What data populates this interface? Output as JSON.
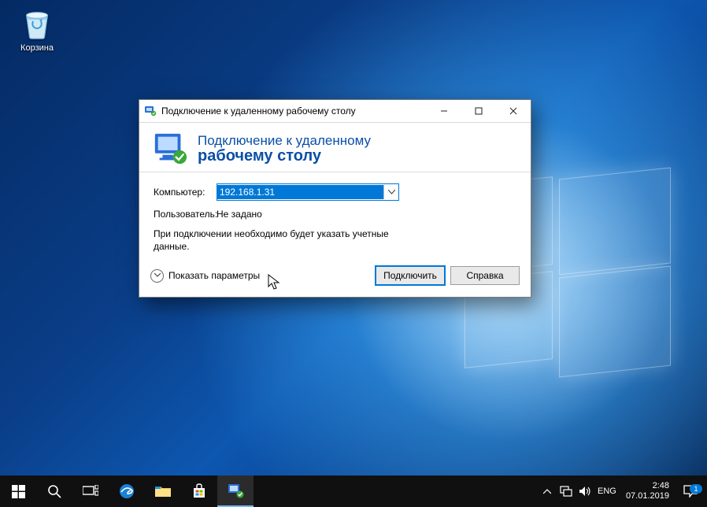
{
  "desktop": {
    "recycle_bin_label": "Корзина"
  },
  "window": {
    "title": "Подключение к удаленному рабочему столу",
    "banner_line1": "Подключение к удаленному",
    "banner_line2": "рабочему столу",
    "computer_label": "Компьютер:",
    "computer_value": "192.168.1.31",
    "user_label": "Пользователь:",
    "user_value": "Не задано",
    "credentials_note": "При подключении необходимо будет указать учетные данные.",
    "show_options": "Показать параметры",
    "connect_btn": "Подключить",
    "help_btn": "Справка"
  },
  "taskbar": {
    "lang": "ENG",
    "time": "2:48",
    "date": "07.01.2019",
    "notification_count": "1"
  }
}
